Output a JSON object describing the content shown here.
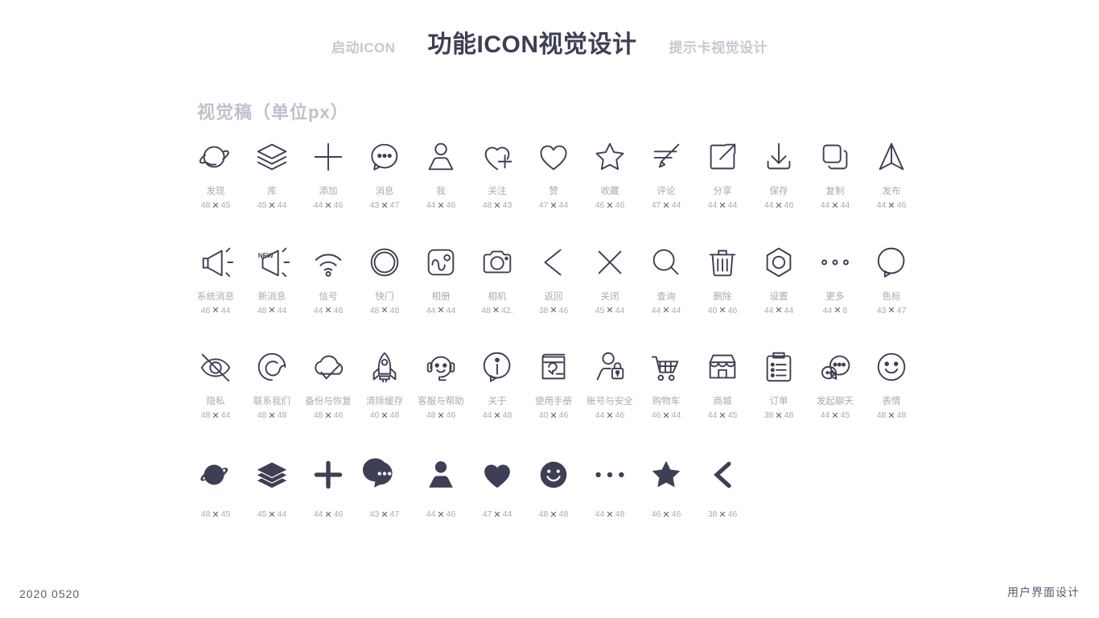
{
  "header": {
    "tab_left": "启动ICON",
    "tab_center": "功能ICON视觉设计",
    "tab_right": "提示卡视觉设计"
  },
  "section": {
    "title": "视觉稿（单位px）"
  },
  "colors": {
    "ink": "#3e3f54",
    "muted": "#a8aab6",
    "title_muted": "#bfc1cc",
    "background": "#ffffff"
  },
  "grid": {
    "rows": [
      {
        "style": "outline",
        "cells": [
          {
            "icon": "planet-icon",
            "label": "发现",
            "w": "48",
            "x": "✕",
            "h": "45"
          },
          {
            "icon": "layers-icon",
            "label": "库",
            "w": "45",
            "x": "✕",
            "h": "44"
          },
          {
            "icon": "plus-icon",
            "label": "添加",
            "w": "44",
            "x": "✕",
            "h": "46"
          },
          {
            "icon": "message-icon",
            "label": "消息",
            "w": "43",
            "x": "✕",
            "h": "47"
          },
          {
            "icon": "user-icon",
            "label": "我",
            "w": "44",
            "x": "✕",
            "h": "46"
          },
          {
            "icon": "heart-plus-icon",
            "label": "关注",
            "w": "48",
            "x": "✕",
            "h": "43"
          },
          {
            "icon": "heart-icon",
            "label": "赞",
            "w": "47",
            "x": "✕",
            "h": "44"
          },
          {
            "icon": "star-icon",
            "label": "收藏",
            "w": "46",
            "x": "✕",
            "h": "46"
          },
          {
            "icon": "pen-comment-icon",
            "label": "评论",
            "w": "47",
            "x": "✕",
            "h": "44"
          },
          {
            "icon": "share-icon",
            "label": "分享",
            "w": "44",
            "x": "✕",
            "h": "44"
          },
          {
            "icon": "download-icon",
            "label": "保存",
            "w": "44",
            "x": "✕",
            "h": "46"
          },
          {
            "icon": "copy-icon",
            "label": "复制",
            "w": "44",
            "x": "✕",
            "h": "44"
          },
          {
            "icon": "publish-icon",
            "label": "发布",
            "w": "44",
            "x": "✕",
            "h": "46"
          }
        ]
      },
      {
        "style": "outline",
        "cells": [
          {
            "icon": "megaphone-icon",
            "label": "系统消息",
            "w": "46",
            "x": "✕",
            "h": "44"
          },
          {
            "icon": "megaphone-new-icon",
            "label": "新消息",
            "w": "48",
            "x": "✕",
            "h": "44"
          },
          {
            "icon": "signal-icon",
            "label": "信号",
            "w": "44",
            "x": "✕",
            "h": "46"
          },
          {
            "icon": "shutter-icon",
            "label": "快门",
            "w": "48",
            "x": "✕",
            "h": "48"
          },
          {
            "icon": "album-icon",
            "label": "相册",
            "w": "44",
            "x": "✕",
            "h": "44"
          },
          {
            "icon": "camera-icon",
            "label": "相机",
            "w": "48",
            "x": "✕",
            "h": "42."
          },
          {
            "icon": "back-icon",
            "label": "返回",
            "w": "38",
            "x": "✕",
            "h": "46"
          },
          {
            "icon": "close-icon",
            "label": "关闭",
            "w": "45",
            "x": "✕",
            "h": "44"
          },
          {
            "icon": "search-icon",
            "label": "查询",
            "w": "44",
            "x": "✕",
            "h": "44"
          },
          {
            "icon": "trash-icon",
            "label": "删除",
            "w": "40",
            "x": "✕",
            "h": "46"
          },
          {
            "icon": "gear-icon",
            "label": "设置",
            "w": "44",
            "x": "✕",
            "h": "44"
          },
          {
            "icon": "more-icon",
            "label": "更多",
            "w": "44",
            "x": "✕",
            "h": "8"
          },
          {
            "icon": "color-label-icon",
            "label": "色标",
            "w": "43",
            "x": "✕",
            "h": "47"
          }
        ]
      },
      {
        "style": "outline",
        "cells": [
          {
            "icon": "eye-off-icon",
            "label": "隐私",
            "w": "48",
            "x": "✕",
            "h": "44"
          },
          {
            "icon": "contact-us-icon",
            "label": "联系我们",
            "w": "48",
            "x": "✕",
            "h": "48"
          },
          {
            "icon": "cloud-backup-icon",
            "label": "备份与恢复",
            "w": "48",
            "x": "✕",
            "h": "46"
          },
          {
            "icon": "rocket-icon",
            "label": "清除缓存",
            "w": "40",
            "x": "✕",
            "h": "48"
          },
          {
            "icon": "headset-icon",
            "label": "客服与帮助",
            "w": "48",
            "x": "✕",
            "h": "46"
          },
          {
            "icon": "info-icon",
            "label": "关于",
            "w": "44",
            "x": "✕",
            "h": "48"
          },
          {
            "icon": "manual-icon",
            "label": "使用手册",
            "w": "40",
            "x": "✕",
            "h": "46"
          },
          {
            "icon": "account-lock-icon",
            "label": "账号与安全",
            "w": "44",
            "x": "✕",
            "h": "46"
          },
          {
            "icon": "cart-icon",
            "label": "购物车",
            "w": "46",
            "x": "✕",
            "h": "44"
          },
          {
            "icon": "shop-icon",
            "label": "商城",
            "w": "44",
            "x": "✕",
            "h": "45"
          },
          {
            "icon": "order-icon",
            "label": "订单",
            "w": "38",
            "x": "✕",
            "h": "48"
          },
          {
            "icon": "start-chat-icon",
            "label": "发起聊天",
            "w": "44",
            "x": "✕",
            "h": "45"
          },
          {
            "icon": "emoji-icon",
            "label": "表情",
            "w": "48",
            "x": "✕",
            "h": "48"
          }
        ]
      },
      {
        "style": "filled",
        "cells": [
          {
            "icon": "planet-filled-icon",
            "label": "",
            "w": "48",
            "x": "✕",
            "h": "45"
          },
          {
            "icon": "layers-filled-icon",
            "label": "",
            "w": "45",
            "x": "✕",
            "h": "44"
          },
          {
            "icon": "plus-filled-icon",
            "label": "",
            "w": "44",
            "x": "✕",
            "h": "46"
          },
          {
            "icon": "message-filled-icon",
            "label": "",
            "w": "43",
            "x": "✕",
            "h": "47"
          },
          {
            "icon": "user-filled-icon",
            "label": "",
            "w": "44",
            "x": "✕",
            "h": "46"
          },
          {
            "icon": "heart-filled-icon",
            "label": "",
            "w": "47",
            "x": "✕",
            "h": "44"
          },
          {
            "icon": "emoji-filled-icon",
            "label": "",
            "w": "48",
            "x": "✕",
            "h": "48"
          },
          {
            "icon": "more-filled-icon",
            "label": "",
            "w": "44",
            "x": "✕",
            "h": "48"
          },
          {
            "icon": "star-filled-icon",
            "label": "",
            "w": "46",
            "x": "✕",
            "h": "46"
          },
          {
            "icon": "back-filled-icon",
            "label": "",
            "w": "38",
            "x": "✕",
            "h": "46"
          }
        ]
      }
    ]
  },
  "footer": {
    "left": "2020  0520",
    "right": "用户界面设计"
  }
}
